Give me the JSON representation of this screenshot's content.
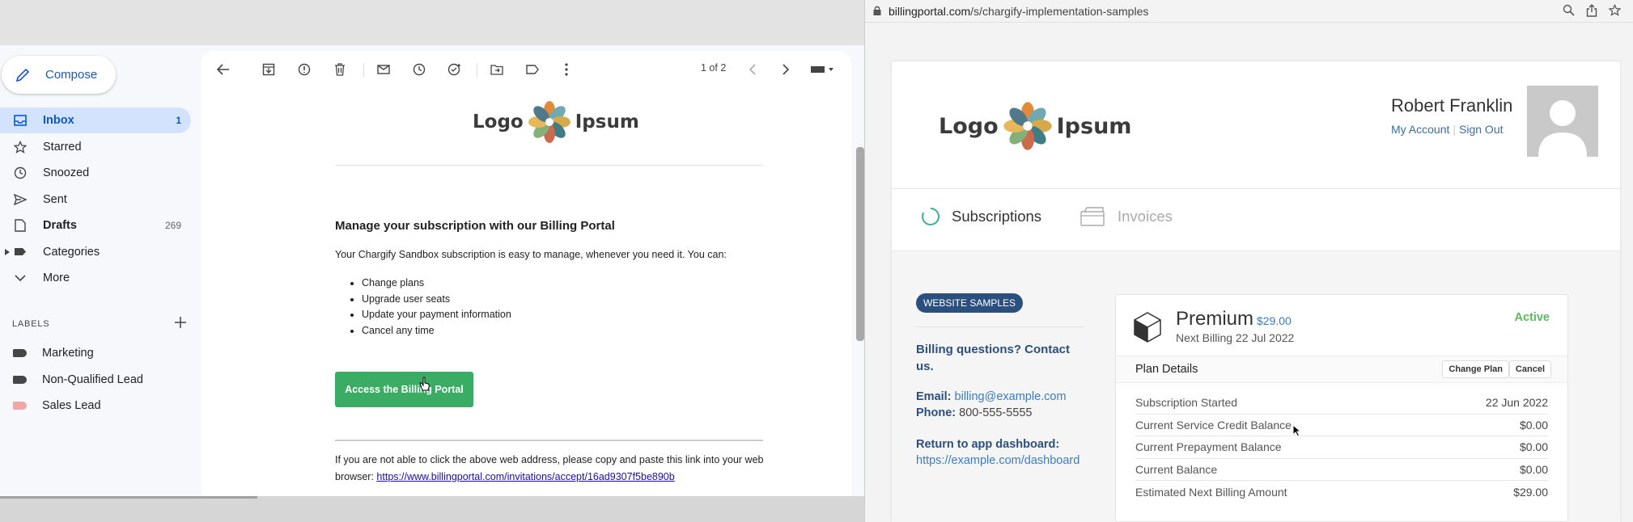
{
  "gmail": {
    "compose_label": "Compose",
    "nav": [
      {
        "label": "Inbox",
        "count": "1",
        "icon": "inbox-icon"
      },
      {
        "label": "Starred",
        "count": "",
        "icon": "star-icon"
      },
      {
        "label": "Snoozed",
        "count": "",
        "icon": "clock-icon"
      },
      {
        "label": "Sent",
        "count": "",
        "icon": "send-icon"
      },
      {
        "label": "Drafts",
        "count": "269",
        "icon": "draft-icon"
      },
      {
        "label": "Categories",
        "count": "",
        "icon": "label-icon"
      },
      {
        "label": "More",
        "count": "",
        "icon": "chevron-down-icon"
      }
    ],
    "labels_heading": "LABELS",
    "labels": [
      {
        "label": "Marketing",
        "color": "#444746"
      },
      {
        "label": "Non-Qualified Lead",
        "color": "#444746"
      },
      {
        "label": "Sales Lead",
        "color": "#f2a6a6"
      }
    ],
    "pager": "1 of 2"
  },
  "email": {
    "logo_left": "Logo",
    "logo_right": "Ipsum",
    "heading": "Manage your subscription with our Billing Portal",
    "intro": "Your Chargify Sandbox subscription is easy to manage, whenever you need it. You can:",
    "bullets": [
      "Change plans",
      "Upgrade user seats",
      "Update your payment information",
      "Cancel any time"
    ],
    "button_label": "Access the Billing Portal",
    "footer_text": "If you are not able to click the above web address, please copy and paste this link into your web browser:",
    "footer_link": "https://www.billingportal.com/invitations/accept/16ad9307f5be890b"
  },
  "browser": {
    "url_domain": "billingportal.com",
    "url_path": "/s/chargify-implementation-samples"
  },
  "portal": {
    "logo_left": "Logo",
    "logo_right": "Ipsum",
    "user_name": "Robert Franklin",
    "my_account": "My Account",
    "sign_out": "Sign Out",
    "tabs": [
      "Subscriptions",
      "Invoices"
    ],
    "badge": "WEBSITE SAMPLES",
    "billing_questions": "Billing questions? Contact us.",
    "email_label": "Email:",
    "email_value": "billing@example.com",
    "phone_label": "Phone:",
    "phone_value": "800-555-5555",
    "return_label": "Return to app dashboard:",
    "return_link": "https://example.com/dashboard",
    "plan": {
      "name": "Premium",
      "price": "$29.00",
      "next_billing": "Next Billing 22 Jul 2022",
      "status": "Active",
      "details_label": "Plan Details",
      "change_plan": "Change Plan",
      "cancel": "Cancel",
      "rows": [
        {
          "label": "Subscription Started",
          "value": "22 Jun 2022"
        },
        {
          "label": "Current Service Credit Balance",
          "value": "$0.00"
        },
        {
          "label": "Current Prepayment Balance",
          "value": "$0.00"
        },
        {
          "label": "Current Balance",
          "value": "$0.00"
        },
        {
          "label": "Estimated Next Billing Amount",
          "value": "$29.00"
        }
      ]
    },
    "colors": {
      "accent": "#2b4f7f",
      "link": "#3a7bc8",
      "active": "#5cb85c",
      "button": "#3aac63"
    }
  }
}
